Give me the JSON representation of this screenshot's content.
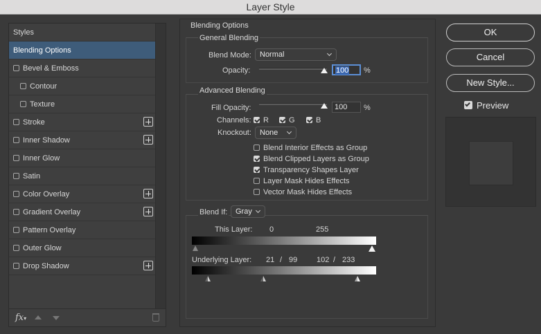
{
  "window": {
    "title": "Layer Style"
  },
  "styles_panel": {
    "header": "Styles",
    "items": [
      {
        "label": "Blending Options",
        "selected": true,
        "checkbox": false,
        "plus": false
      },
      {
        "label": "Bevel & Emboss",
        "checkbox": true,
        "plus": false
      },
      {
        "label": "Contour",
        "checkbox": true,
        "indent": true,
        "plus": false
      },
      {
        "label": "Texture",
        "checkbox": true,
        "indent": true,
        "plus": false
      },
      {
        "label": "Stroke",
        "checkbox": true,
        "plus": true
      },
      {
        "label": "Inner Shadow",
        "checkbox": true,
        "plus": true
      },
      {
        "label": "Inner Glow",
        "checkbox": true,
        "plus": false
      },
      {
        "label": "Satin",
        "checkbox": true,
        "plus": false
      },
      {
        "label": "Color Overlay",
        "checkbox": true,
        "plus": true
      },
      {
        "label": "Gradient Overlay",
        "checkbox": true,
        "plus": true
      },
      {
        "label": "Pattern Overlay",
        "checkbox": true,
        "plus": false
      },
      {
        "label": "Outer Glow",
        "checkbox": true,
        "plus": false
      },
      {
        "label": "Drop Shadow",
        "checkbox": true,
        "plus": true
      }
    ],
    "footer": {
      "fx_label": "fx"
    }
  },
  "blending": {
    "title": "Blending Options",
    "general": {
      "title": "General Blending",
      "blend_mode_label": "Blend Mode:",
      "blend_mode_value": "Normal",
      "opacity_label": "Opacity:",
      "opacity_value": "100",
      "opacity_unit": "%",
      "opacity_fraction": 1.0
    },
    "advanced": {
      "title": "Advanced Blending",
      "fill_opacity_label": "Fill Opacity:",
      "fill_opacity_value": "100",
      "fill_opacity_unit": "%",
      "fill_opacity_fraction": 1.0,
      "channels_label": "Channels:",
      "channels": [
        {
          "label": "R",
          "checked": true
        },
        {
          "label": "G",
          "checked": true
        },
        {
          "label": "B",
          "checked": true
        }
      ],
      "knockout_label": "Knockout:",
      "knockout_value": "None",
      "options": [
        {
          "label": "Blend Interior Effects as Group",
          "checked": false
        },
        {
          "label": "Blend Clipped Layers as Group",
          "checked": true
        },
        {
          "label": "Transparency Shapes Layer",
          "checked": true
        },
        {
          "label": "Layer Mask Hides Effects",
          "checked": false
        },
        {
          "label": "Vector Mask Hides Effects",
          "checked": false
        }
      ]
    },
    "blend_if": {
      "label": "Blend If:",
      "value": "Gray",
      "this_layer": {
        "label": "This Layer:",
        "low": "0",
        "high": "255"
      },
      "underlying_layer": {
        "label": "Underlying Layer:",
        "low_a": "21",
        "sep1": "/",
        "low_b": "99",
        "high_a": "102",
        "sep2": "/",
        "high_b": "233"
      }
    }
  },
  "buttons": {
    "ok": "OK",
    "cancel": "Cancel",
    "new_style": "New Style...",
    "preview_label": "Preview",
    "preview_checked": true
  }
}
